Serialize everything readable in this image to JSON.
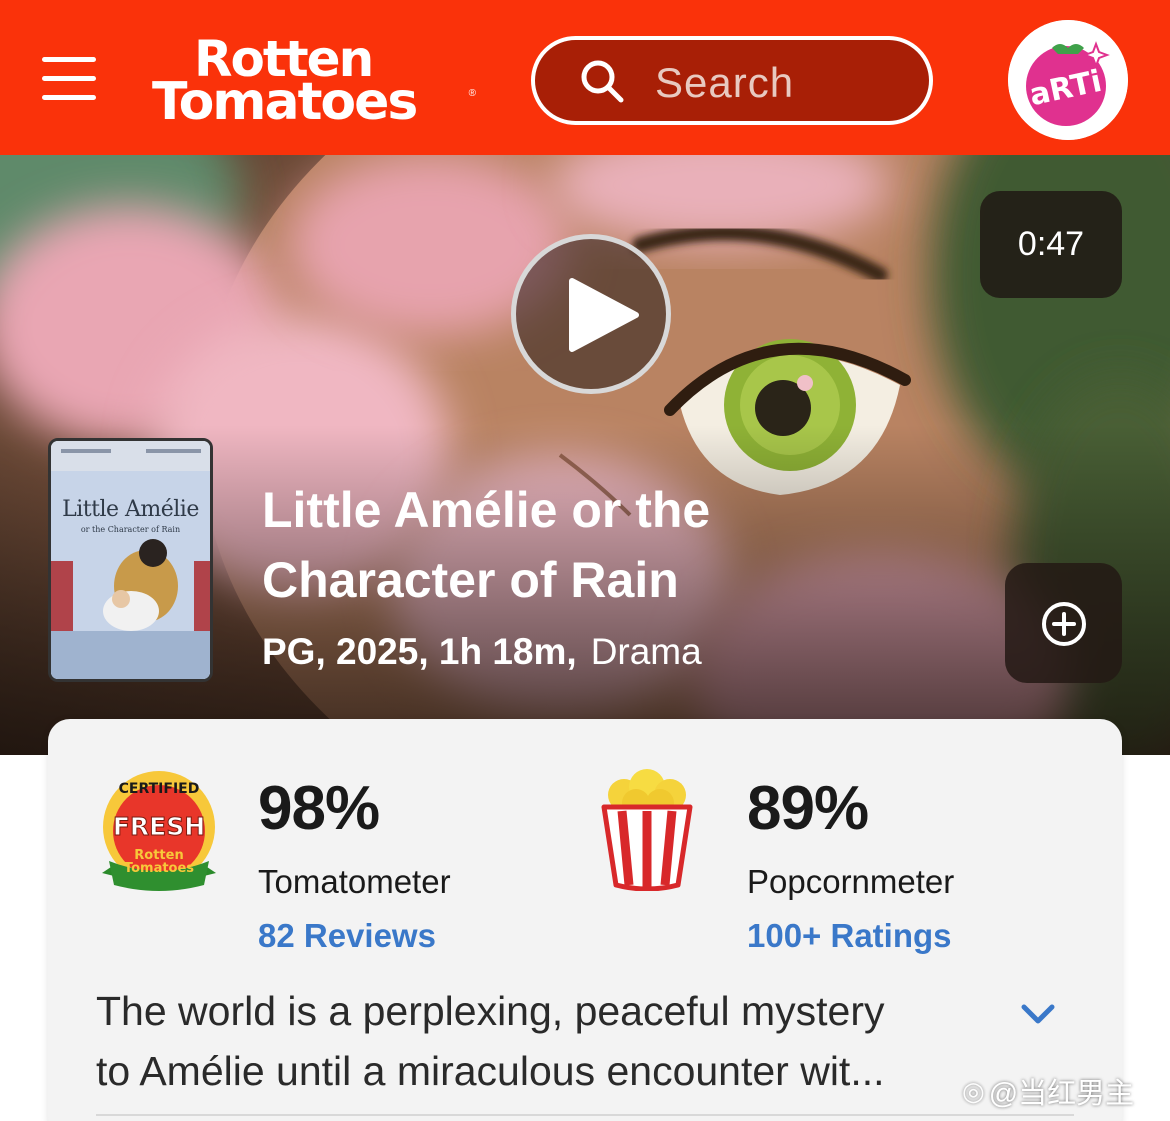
{
  "header": {
    "logo_line1": "Rotten",
    "logo_line2": "Tomatoes",
    "logo_registered": "®",
    "search_placeholder": "Search",
    "avatar_text": "aRTi",
    "brand_color": "#fa320a"
  },
  "hero": {
    "duration": "0:47",
    "poster_title": "Little Amélie",
    "poster_subtitle": "or the Character of Rain",
    "title": "Little Amélie or the Character of Rain",
    "meta": "PG, 2025, 1h 18m,",
    "genre": "Drama"
  },
  "scores": {
    "certified_badge": {
      "top": "CERTIFIED",
      "middle": "FRESH",
      "bottom_line1": "Rotten",
      "bottom_line2": "Tomatoes"
    },
    "tomatometer": {
      "value": "98%",
      "label": "Tomatometer",
      "link": "82 Reviews"
    },
    "popcornmeter": {
      "value": "89%",
      "label": "Popcornmeter",
      "link": "100+ Ratings"
    },
    "link_color": "#3a78c9"
  },
  "synopsis": {
    "line1": "The world is a perplexing, peaceful mystery",
    "line2": "to Amélie until a miraculous encounter wit..."
  },
  "watermark": "@当红男主",
  "icons": {
    "menu": "hamburger-menu-icon",
    "search": "search-icon",
    "play": "play-icon",
    "add": "plus-circle-icon",
    "expand": "chevron-down-icon"
  }
}
